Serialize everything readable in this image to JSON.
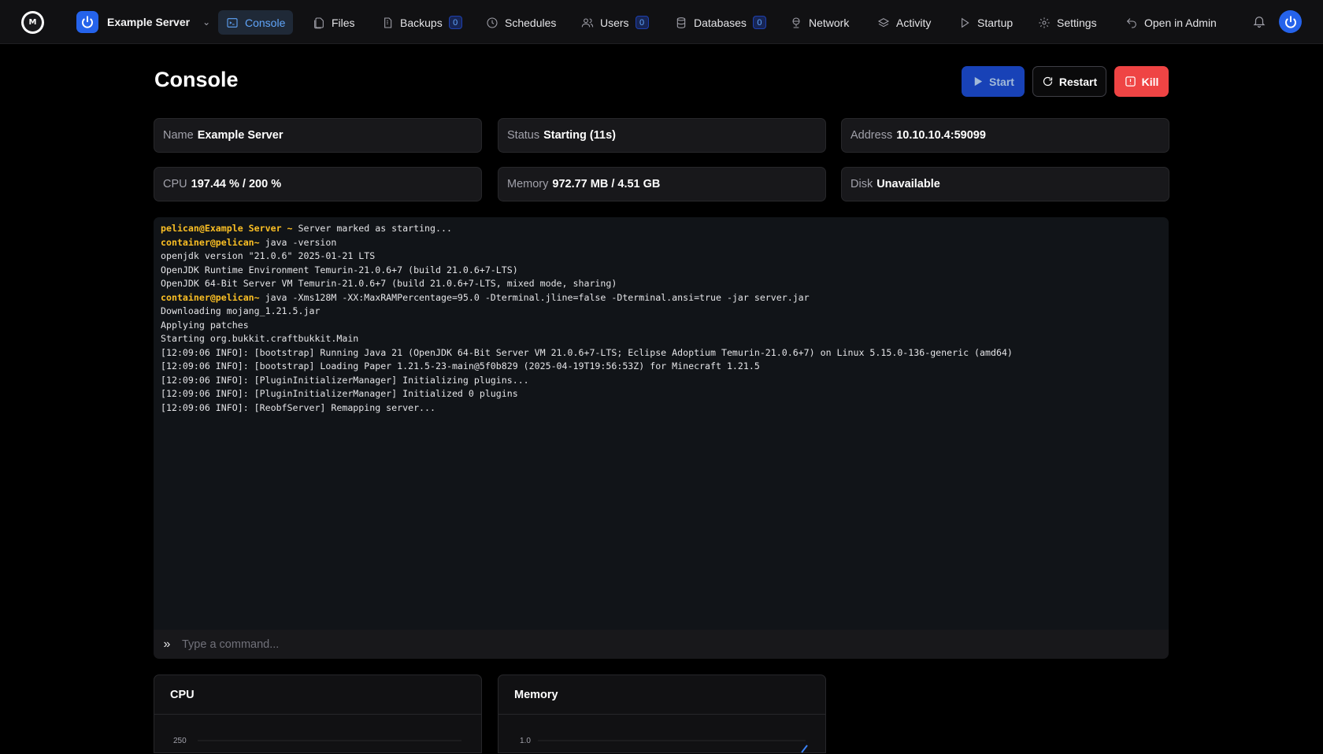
{
  "nav": {
    "server_name": "Example Server",
    "items": [
      {
        "label": "Console",
        "icon": "terminal-icon",
        "badge": null,
        "active": true
      },
      {
        "label": "Files",
        "icon": "files-icon",
        "badge": null
      },
      {
        "label": "Backups",
        "icon": "backup-icon",
        "badge": "0"
      },
      {
        "label": "Schedules",
        "icon": "clock-icon",
        "badge": null
      },
      {
        "label": "Users",
        "icon": "users-icon",
        "badge": "0"
      },
      {
        "label": "Databases",
        "icon": "database-icon",
        "badge": "0"
      },
      {
        "label": "Network",
        "icon": "network-icon",
        "badge": null
      },
      {
        "label": "Activity",
        "icon": "layers-icon",
        "badge": null
      },
      {
        "label": "Startup",
        "icon": "play-icon",
        "badge": null
      },
      {
        "label": "Settings",
        "icon": "gear-icon",
        "badge": null
      },
      {
        "label": "Open in Admin",
        "icon": "return-icon",
        "badge": null
      }
    ]
  },
  "header": {
    "title": "Console",
    "start_label": "Start",
    "restart_label": "Restart",
    "kill_label": "Kill"
  },
  "stats": {
    "name": {
      "label": "Name",
      "value": "Example Server"
    },
    "status": {
      "label": "Status",
      "value": "Starting (11s)"
    },
    "address": {
      "label": "Address",
      "value": "10.10.10.4:59099"
    },
    "cpu": {
      "label": "CPU",
      "value": "197.44 % / 200 %"
    },
    "memory": {
      "label": "Memory",
      "value": "972.77 MB / 4.51 GB"
    },
    "disk": {
      "label": "Disk",
      "value": "Unavailable"
    }
  },
  "console": {
    "lines": [
      {
        "prompt": "pelican@Example Server ~",
        "text": " Server marked as starting..."
      },
      {
        "prompt": "container@pelican~",
        "text": " java -version"
      },
      {
        "prompt": "",
        "text": "openjdk version \"21.0.6\" 2025-01-21 LTS"
      },
      {
        "prompt": "",
        "text": "OpenJDK Runtime Environment Temurin-21.0.6+7 (build 21.0.6+7-LTS)"
      },
      {
        "prompt": "",
        "text": "OpenJDK 64-Bit Server VM Temurin-21.0.6+7 (build 21.0.6+7-LTS, mixed mode, sharing)"
      },
      {
        "prompt": "container@pelican~",
        "text": " java -Xms128M -XX:MaxRAMPercentage=95.0 -Dterminal.jline=false -Dterminal.ansi=true -jar server.jar"
      },
      {
        "prompt": "",
        "text": "Downloading mojang_1.21.5.jar"
      },
      {
        "prompt": "",
        "text": "Applying patches"
      },
      {
        "prompt": "",
        "text": "Starting org.bukkit.craftbukkit.Main"
      },
      {
        "prompt": "",
        "text": "[12:09:06 INFO]: [bootstrap] Running Java 21 (OpenJDK 64-Bit Server VM 21.0.6+7-LTS; Eclipse Adoptium Temurin-21.0.6+7) on Linux 5.15.0-136-generic (amd64)"
      },
      {
        "prompt": "",
        "text": "[12:09:06 INFO]: [bootstrap] Loading Paper 1.21.5-23-main@5f0b829 (2025-04-19T19:56:53Z) for Minecraft 1.21.5"
      },
      {
        "prompt": "",
        "text": "[12:09:06 INFO]: [PluginInitializerManager] Initializing plugins..."
      },
      {
        "prompt": "",
        "text": "[12:09:06 INFO]: [PluginInitializerManager] Initialized 0 plugins"
      },
      {
        "prompt": "",
        "text": "[12:09:06 INFO]: [ReobfServer] Remapping server..."
      }
    ],
    "command_placeholder": "Type a command..."
  },
  "chart_data": [
    {
      "type": "line",
      "title": "CPU",
      "ylim": [
        0,
        250
      ],
      "tick_labels": [
        "250"
      ],
      "series": [
        {
          "values": []
        }
      ]
    },
    {
      "type": "line",
      "title": "Memory",
      "ylim": [
        0,
        1.0
      ],
      "tick_labels": [
        "1.0"
      ],
      "series": [
        {
          "values": []
        }
      ]
    }
  ],
  "colors": {
    "accent": "#2563eb",
    "danger": "#ef4444",
    "prompt": "#fbbf24"
  }
}
